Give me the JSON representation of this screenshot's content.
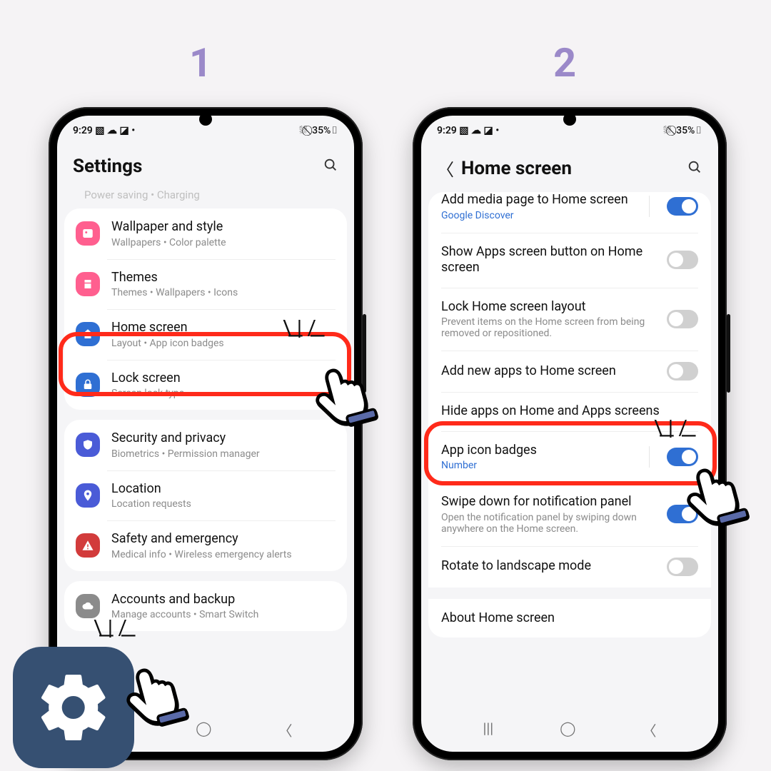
{
  "steps": {
    "one": "1",
    "two": "2"
  },
  "statusbar": {
    "time": "9:29",
    "icons": "▧ ☁ ◪ •",
    "right": "⛆ ⃠ 35%▯"
  },
  "phone1": {
    "title": "Settings",
    "cut": "Power saving  •  Charging",
    "groups": [
      {
        "rows": [
          {
            "color": "#ff5f8f",
            "icon": "image",
            "title": "Wallpaper and style",
            "sub": "Wallpapers  •  Color palette"
          },
          {
            "color": "#ff5f8f",
            "icon": "themes",
            "title": "Themes",
            "sub": "Themes  •  Wallpapers  •  Icons"
          },
          {
            "color": "#2f6fd3",
            "icon": "home",
            "title": "Home screen",
            "sub": "Layout  •  App icon badges"
          },
          {
            "color": "#2f6fd3",
            "icon": "lock",
            "title": "Lock screen",
            "sub": "Screen lock type"
          }
        ]
      },
      {
        "rows": [
          {
            "color": "#4a5bd7",
            "icon": "shield",
            "title": "Security and privacy",
            "sub": "Biometrics  •  Permission manager"
          },
          {
            "color": "#4a5bd7",
            "icon": "pin",
            "title": "Location",
            "sub": "Location requests"
          },
          {
            "color": "#d23b3b",
            "icon": "alert",
            "title": "Safety and emergency",
            "sub": "Medical info  •  Wireless emergency alerts"
          }
        ]
      },
      {
        "rows": [
          {
            "color": "#8b8b8b",
            "icon": "cloud",
            "title": "Accounts and backup",
            "sub": "Manage accounts  •  Smart Switch"
          }
        ]
      }
    ]
  },
  "phone2": {
    "title": "Home screen",
    "rows": [
      {
        "title": "Add media page to Home screen",
        "link": "Google Discover",
        "toggle": "on",
        "divider": true,
        "cutTop": true
      },
      {
        "title": "Show Apps screen button on Home screen",
        "toggle": "off"
      },
      {
        "title": "Lock Home screen layout",
        "sub": "Prevent items on the Home screen from being removed or repositioned.",
        "toggle": "off"
      },
      {
        "title": "Add new apps to Home screen",
        "toggle": "off"
      },
      {
        "title": "Hide apps on Home and Apps screens"
      },
      {
        "title": "App icon badges",
        "link": "Number",
        "toggle": "on",
        "divider": true
      },
      {
        "title": "Swipe down for notification panel",
        "sub": "Open the notification panel by swiping down anywhere on the Home screen.",
        "toggle": "on"
      },
      {
        "title": "Rotate to landscape mode",
        "toggle": "off"
      },
      {
        "spacer": true
      },
      {
        "title": "About Home screen"
      }
    ]
  }
}
